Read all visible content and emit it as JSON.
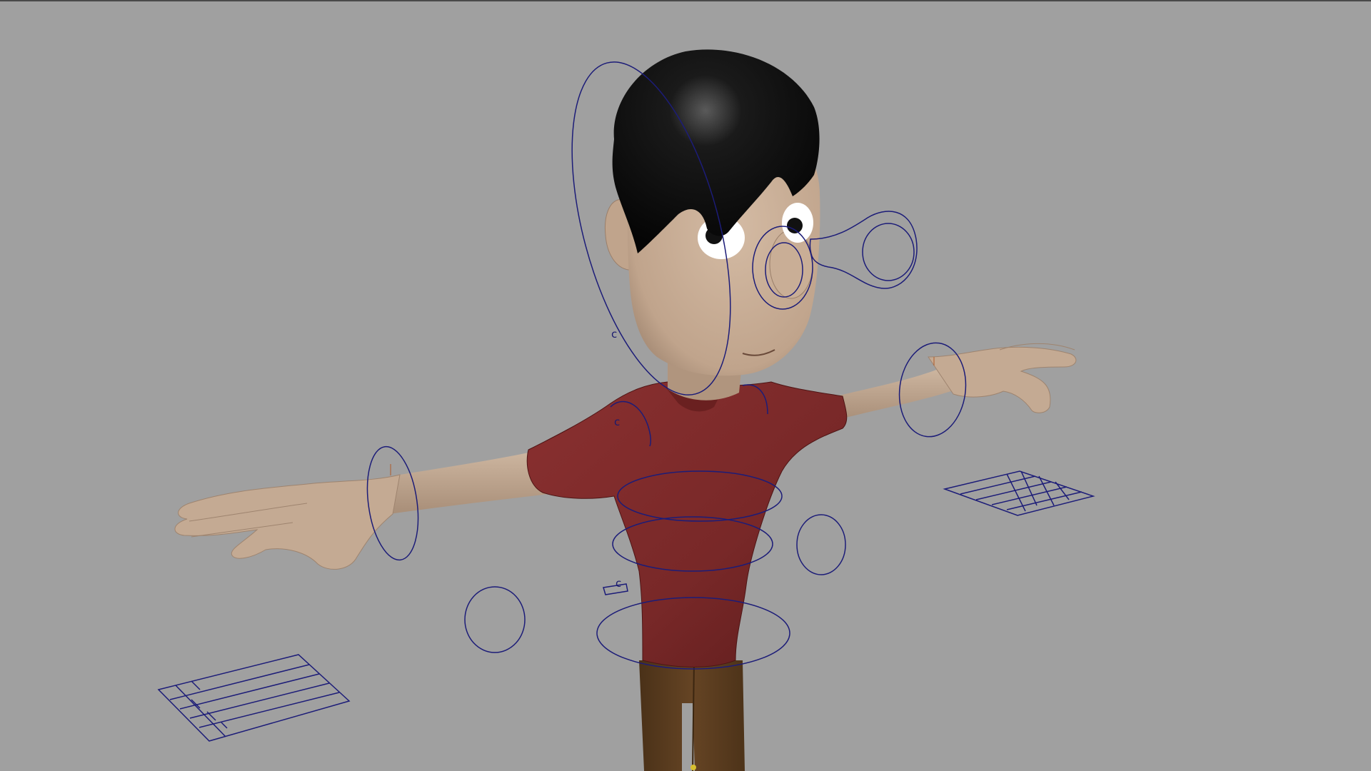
{
  "viewport": {
    "background": "#a0a0a0"
  },
  "scene": {
    "character": {
      "hair_color": "#0c0c0c",
      "skin_color": "#c2a790",
      "shirt_color": "#7a2a2a",
      "pants_color": "#5a3d1e",
      "pose": "T-pose"
    },
    "controls": {
      "curve_color": "#1c1c78",
      "labels": {
        "head_label": "c",
        "chest_label": "c",
        "hip_label": "c"
      }
    }
  }
}
